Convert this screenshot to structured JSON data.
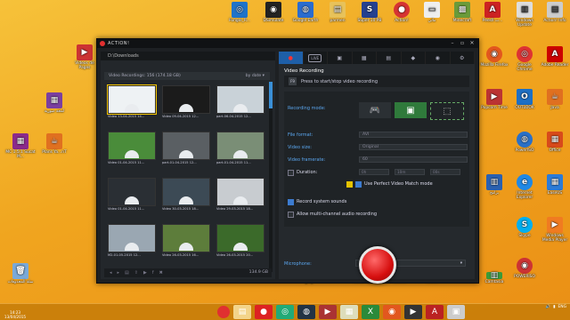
{
  "desktop": {
    "left_icons": [
      {
        "label": "Videos de Pages",
        "color": "#c33",
        "glyph": "▶"
      },
      {
        "label": "لمحة صورية",
        "color": "#7a3fa0",
        "glyph": "▦"
      },
      {
        "label": "MC 1.5.1 Sucat M...",
        "color": "#8b2a8b",
        "glyph": "▦"
      },
      {
        "label": "Plans Ya...nT",
        "color": "#e07020",
        "glyph": "☕"
      },
      {
        "label": "سلة المحذوفات",
        "color": "#7aa9d8",
        "glyph": "🗑"
      }
    ],
    "top_icons": [
      {
        "label": "Fungol_R...",
        "color": "#1f73c8",
        "glyph": "◎"
      },
      {
        "label": "DSimulate",
        "color": "#222",
        "glyph": "◉"
      },
      {
        "label": "Google Earth",
        "color": "#2a6ccf",
        "glyph": "◍"
      },
      {
        "label": "parmen",
        "color": "#e8c25a",
        "glyph": "▤"
      },
      {
        "label": "Super 10 PB",
        "color": "#24408f",
        "glyph": "S"
      },
      {
        "label": "Action!",
        "color": "#d63333",
        "glyph": "●"
      },
      {
        "label": "مالي",
        "color": "#eee",
        "glyph": "▭"
      },
      {
        "label": "Minecraft",
        "color": "#6a9b3a",
        "glyph": "▩"
      },
      {
        "label": "PeesII ت...",
        "color": "#c22",
        "glyph": "A"
      },
      {
        "label": "Windows Update",
        "color": "#ddd",
        "glyph": "▥"
      },
      {
        "label": "Action! Info",
        "color": "#ccc",
        "glyph": "▤"
      }
    ],
    "right_icons": [
      {
        "label": "Mozilla Firefox",
        "color": "#e2571e",
        "glyph": "◉"
      },
      {
        "label": "Google Chrome",
        "color": "#d33",
        "glyph": "◎"
      },
      {
        "label": "Adobe Reader",
        "color": "#c00",
        "glyph": "A"
      },
      {
        "label": "Popcorn Time",
        "color": "#b33",
        "glyph": "▶"
      },
      {
        "label": "OUTLOOK",
        "color": "#1d6fc4",
        "glyph": "O"
      },
      {
        "label": "Java",
        "color": "#e07020",
        "glyph": "☕"
      },
      {
        "label": "PowerISO",
        "color": "#2a70c8",
        "glyph": "◍"
      },
      {
        "label": "Office",
        "color": "#d84a1b",
        "glyph": "▦"
      },
      {
        "label": "Internet Explorer",
        "color": "#1f88e5",
        "glyph": "e"
      },
      {
        "label": "Skype",
        "color": "#00aff0",
        "glyph": "S"
      },
      {
        "label": "برامج",
        "color": "#2a60b0",
        "glyph": "▥"
      },
      {
        "label": "EaseUS",
        "color": "#2b7bd8",
        "glyph": "▦"
      },
      {
        "label": "Windows Media Player",
        "color": "#f07b21",
        "glyph": "▶"
      }
    ],
    "behind_icons": [
      {
        "label": "وثائق",
        "color": "#eee",
        "glyph": "▤"
      },
      {
        "label": "Paint7 Portable",
        "color": "#e66",
        "glyph": "▦"
      },
      {
        "label": "Builder",
        "color": "#ccc",
        "glyph": "▤"
      },
      {
        "label": "Rallize",
        "color": "#333",
        "glyph": "▦"
      },
      {
        "label": "Camtasia",
        "color": "#3a9a3a",
        "glyph": "▥"
      },
      {
        "label": "POWERISO",
        "color": "#c33",
        "glyph": "◉"
      }
    ]
  },
  "taskbar": {
    "time": "14:23",
    "date": "13/04/2015",
    "lang": "ENG",
    "items": [
      {
        "name": "explorer",
        "glyph": "▤",
        "color": "#f3d48a"
      },
      {
        "name": "action",
        "glyph": "●",
        "color": "#d22"
      },
      {
        "name": "chrome",
        "glyph": "◎",
        "color": "#2a7"
      },
      {
        "name": "steam",
        "glyph": "◍",
        "color": "#234"
      },
      {
        "name": "video",
        "glyph": "▶",
        "color": "#a33"
      },
      {
        "name": "files",
        "glyph": "▦",
        "color": "#ddb"
      },
      {
        "name": "excel",
        "glyph": "X",
        "color": "#2a8a3a"
      },
      {
        "name": "firefox",
        "glyph": "◉",
        "color": "#e2571e"
      },
      {
        "name": "media",
        "glyph": "▶",
        "color": "#333"
      },
      {
        "name": "adobe",
        "glyph": "A",
        "color": "#b22"
      },
      {
        "name": "app",
        "glyph": "▣",
        "color": "#ccc"
      }
    ]
  },
  "window": {
    "title": "ACTION!",
    "path": "D:\\Downloads",
    "list_header": "Video Recordings: 156 (174.18 GB)",
    "sort_label": "by date",
    "free_space": "134.9 GB",
    "thumbs": [
      {
        "cap": "Video 13-04-2015 14...",
        "bg": "#eef2f4",
        "sel": true
      },
      {
        "cap": "Video 09-04-2015 12...",
        "bg": "#1b1b1b",
        "sel": false
      },
      {
        "cap": "part-06-04-2015 12...",
        "bg": "#c9d2d8",
        "sel": false
      },
      {
        "cap": "Video 01-04-2015 11...",
        "bg": "#4a8c3a",
        "sel": false
      },
      {
        "cap": "part-01-04-2015 12...",
        "bg": "#5a5f63",
        "sel": false
      },
      {
        "cap": "part-01-04-2015 11...",
        "bg": "#7a8e76",
        "sel": false
      },
      {
        "cap": "Video 01-04-2015 11...",
        "bg": "#2a2f34",
        "sel": false
      },
      {
        "cap": "Video 30-03-2015 18...",
        "bg": "#3c4a55",
        "sel": false
      },
      {
        "cap": "Video 29-03-2015 18...",
        "bg": "#c8ccd0",
        "sel": false
      },
      {
        "cap": "M2-01-05-2015 12...",
        "bg": "#9aa7b2",
        "sel": false
      },
      {
        "cap": "Video 26-03-2015 16...",
        "bg": "#5d7d3b",
        "sel": false
      },
      {
        "cap": "Video 26-03-2015 20...",
        "bg": "#3b6a2a",
        "sel": false
      }
    ],
    "tabs": [
      "●",
      "LIVE",
      "▣",
      "▦",
      "▤",
      "◆",
      "◉",
      "⚙"
    ],
    "section_title": "Video Recording",
    "press_key": "Press to start/stop video recording",
    "key_name": "F9",
    "labels": {
      "recording_mode": "Recording mode:",
      "file_format": "File format:",
      "video_size": "Video size:",
      "video_framerate": "Video framerate:",
      "duration": "Duration:",
      "use_perfect": "Use Perfect Video Match mode",
      "record_system": "Record system sounds",
      "multi_channel": "Allow multi-channel audio recording",
      "microphone": "Microphone:"
    },
    "values": {
      "file_format": "AVI",
      "video_size": "Original",
      "video_framerate": "60",
      "duration_h": "0h",
      "duration_m": "10m",
      "duration_s": "00s",
      "microphone": "Always record"
    }
  }
}
